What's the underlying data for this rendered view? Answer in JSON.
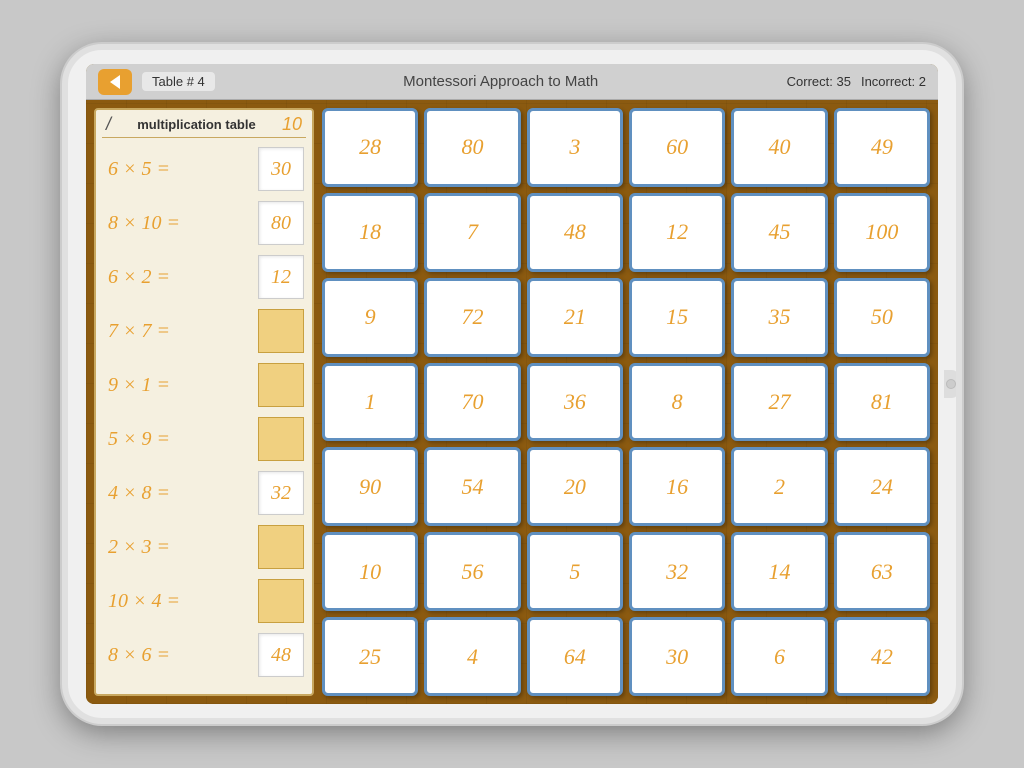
{
  "header": {
    "back_label": "◀",
    "table_prefix": "Table #",
    "table_number": "4",
    "title": "Montessori Approach to Math",
    "correct_label": "Correct:",
    "correct_value": "35",
    "incorrect_label": "Incorrect:",
    "incorrect_value": "2"
  },
  "left_panel": {
    "slash": "/",
    "title": "multiplication table",
    "ten": "10",
    "equations": [
      {
        "left": "6 × 5 =",
        "result": "30",
        "empty": false
      },
      {
        "left": "8 × 10 =",
        "result": "80",
        "empty": false
      },
      {
        "left": "6 × 2 =",
        "result": "12",
        "empty": false
      },
      {
        "left": "7 × 7 =",
        "result": "",
        "empty": true
      },
      {
        "left": "9 × 1 =",
        "result": "",
        "empty": true
      },
      {
        "left": "5 × 9 =",
        "result": "",
        "empty": true
      },
      {
        "left": "4 × 8 =",
        "result": "32",
        "empty": false
      },
      {
        "left": "2 × 3 =",
        "result": "",
        "empty": true
      },
      {
        "left": "10 × 4 =",
        "result": "",
        "empty": true
      },
      {
        "left": "8 × 6 =",
        "result": "48",
        "empty": false
      }
    ]
  },
  "tiles": [
    "28",
    "80",
    "3",
    "60",
    "40",
    "49",
    "18",
    "7",
    "48",
    "12",
    "45",
    "100",
    "9",
    "72",
    "21",
    "15",
    "35",
    "50",
    "1",
    "70",
    "36",
    "8",
    "27",
    "81",
    "90",
    "54",
    "20",
    "16",
    "2",
    "24",
    "10",
    "56",
    "5",
    "32",
    "14",
    "63",
    "25",
    "4",
    "64",
    "30",
    "6",
    "42"
  ]
}
